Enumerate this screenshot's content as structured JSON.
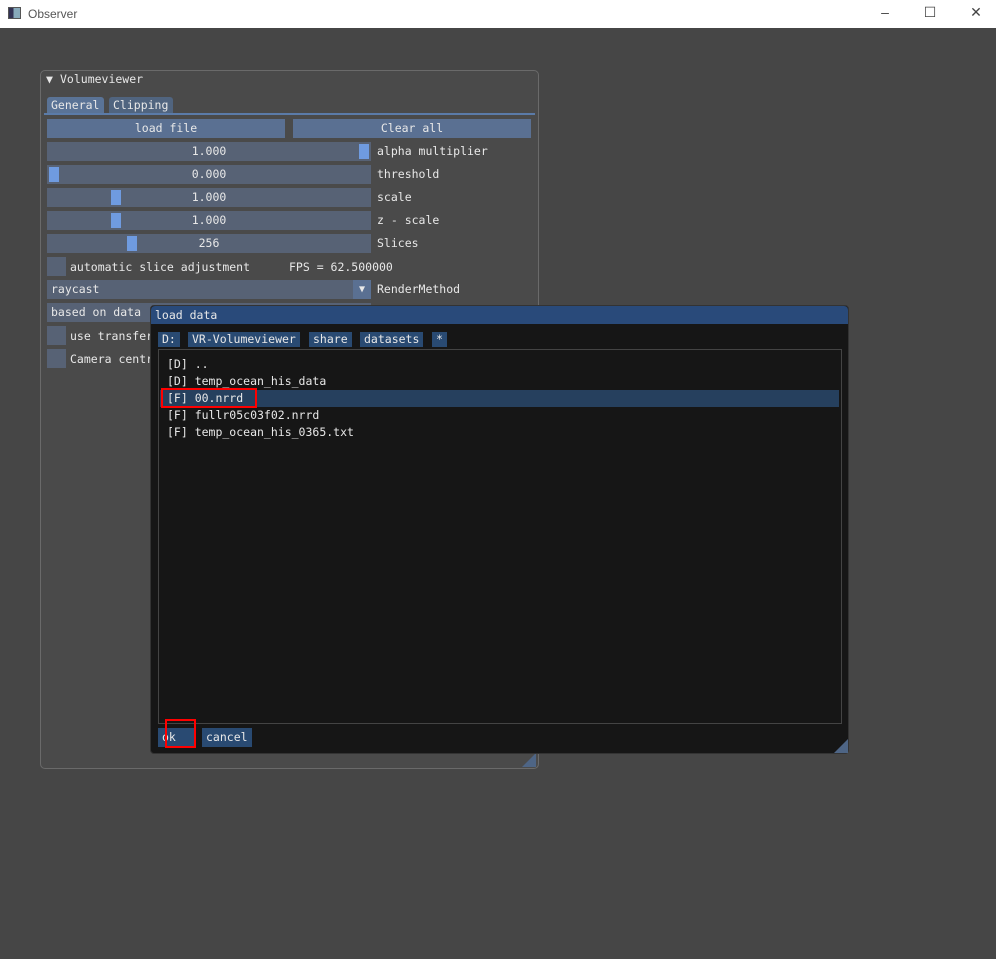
{
  "window": {
    "title": "Observer",
    "minimize": "–",
    "maximize": "☐",
    "close": "✕"
  },
  "panel": {
    "title": "Volumeviewer",
    "collapse_glyph": "▼",
    "tabs": [
      {
        "label": "General",
        "active": true
      },
      {
        "label": "Clipping",
        "active": false
      }
    ],
    "load_file": "load file",
    "clear_all": "Clear all",
    "sliders": [
      {
        "value": "1.000",
        "label": "alpha multiplier",
        "fraction": 1.0
      },
      {
        "value": "0.000",
        "label": "threshold",
        "fraction": 0.0
      },
      {
        "value": "1.000",
        "label": "scale",
        "fraction": 0.2
      },
      {
        "value": "1.000",
        "label": "z - scale",
        "fraction": 0.2
      },
      {
        "value": "256",
        "label": "Slices",
        "fraction": 0.25
      }
    ],
    "auto_slice": "automatic slice adjustment",
    "fps": "FPS = 62.500000",
    "render_method": {
      "value": "raycast",
      "label": "RenderMethod"
    },
    "based_on_data": "based on data",
    "use_transfer": "use transfer",
    "camera_centric": "Camera centric rotations"
  },
  "dialog": {
    "title": "load data",
    "path": [
      "D:",
      "VR-Volumeviewer",
      "share",
      "datasets",
      "*"
    ],
    "items": [
      "[D] ..",
      "[D] temp_ocean_his_data",
      "[F] 00.nrrd",
      "[F] fullr05c03f02.nrrd",
      "[F] temp_ocean_his_0365.txt"
    ],
    "selected_index": 2,
    "ok": "ok",
    "cancel": "cancel"
  },
  "colors": {
    "accent": "#6f9be0",
    "dialog_title": "#294a7a",
    "highlight": "#ff0000"
  }
}
